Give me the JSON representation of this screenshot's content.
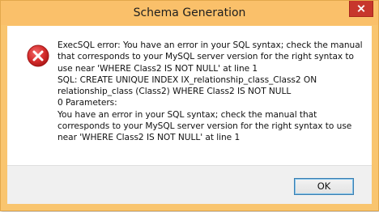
{
  "window": {
    "title": "Schema Generation"
  },
  "icons": {
    "error": "error-icon",
    "close": "close-icon"
  },
  "message": {
    "lines": [
      "ExecSQL error: You have an error in your SQL syntax; check the manual",
      "that corresponds to your MySQL server version for the right syntax to",
      "use near 'WHERE Class2 IS NOT NULL' at line 1",
      "SQL: CREATE UNIQUE INDEX IX_relationship_class_Class2 ON",
      "relationship_class (Class2) WHERE Class2 IS NOT NULL",
      "0 Parameters:",
      "You have an error in your SQL syntax; check the manual that",
      "corresponds to your MySQL server version for the right syntax to use",
      "near 'WHERE Class2 IS NOT NULL' at line 1"
    ]
  },
  "buttons": {
    "ok_label": "OK"
  },
  "colors": {
    "title_bar": "#fac06a",
    "close_button": "#c7362c",
    "error_icon": "#d42b2b",
    "ok_border": "#3c7fb1"
  }
}
